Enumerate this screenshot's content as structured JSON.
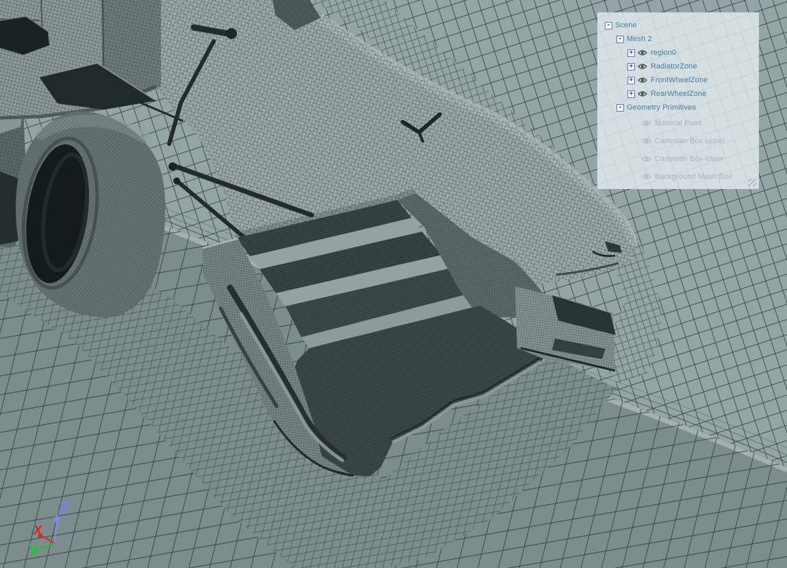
{
  "viewport": {
    "colors": {
      "wall_background": "#95a4a6",
      "floor_background": "#7d8d8f",
      "grid_line": "#2e3b3e",
      "junction_highlight": "#a6b3b4",
      "mesh_surface_light": "#a9b7b8",
      "mesh_surface_dark": "#2c3739",
      "tire_mesh": "#6f7d7f"
    },
    "axis": {
      "x": {
        "label": "X",
        "color": "#d7281a"
      },
      "y": {
        "label": "Y",
        "color": "#2fbd45"
      },
      "z": {
        "label": "Z",
        "color": "#7a7ef2"
      }
    }
  },
  "scene_tree": {
    "items": [
      {
        "label": "Scene",
        "level": 0,
        "box": "-",
        "eye": null,
        "enabled": true
      },
      {
        "label": "Mesh 2",
        "level": 1,
        "box": "-",
        "eye": null,
        "enabled": true
      },
      {
        "label": "region0",
        "level": 2,
        "box": "+",
        "eye": "on",
        "enabled": true
      },
      {
        "label": "RadiatorZone",
        "level": 2,
        "box": "+",
        "eye": "on",
        "enabled": true
      },
      {
        "label": "FrontWheelZone",
        "level": 2,
        "box": "+",
        "eye": "on",
        "enabled": true
      },
      {
        "label": "RearWheelZone",
        "level": 2,
        "box": "+",
        "eye": "on",
        "enabled": true
      },
      {
        "label": "Geometry Primitives",
        "level": 1,
        "box": "-",
        "eye": null,
        "enabled": true
      },
      {
        "label": "Material Point",
        "level": 3,
        "box": null,
        "eye": "off",
        "enabled": false
      },
      {
        "label": "Cartesian Box-upper",
        "level": 3,
        "box": null,
        "eye": "off",
        "enabled": false
      },
      {
        "label": "Cartesian Box-lower",
        "level": 3,
        "box": null,
        "eye": "off",
        "enabled": false
      },
      {
        "label": "Background Mesh Box",
        "level": 3,
        "box": null,
        "eye": "off",
        "enabled": false
      }
    ]
  }
}
